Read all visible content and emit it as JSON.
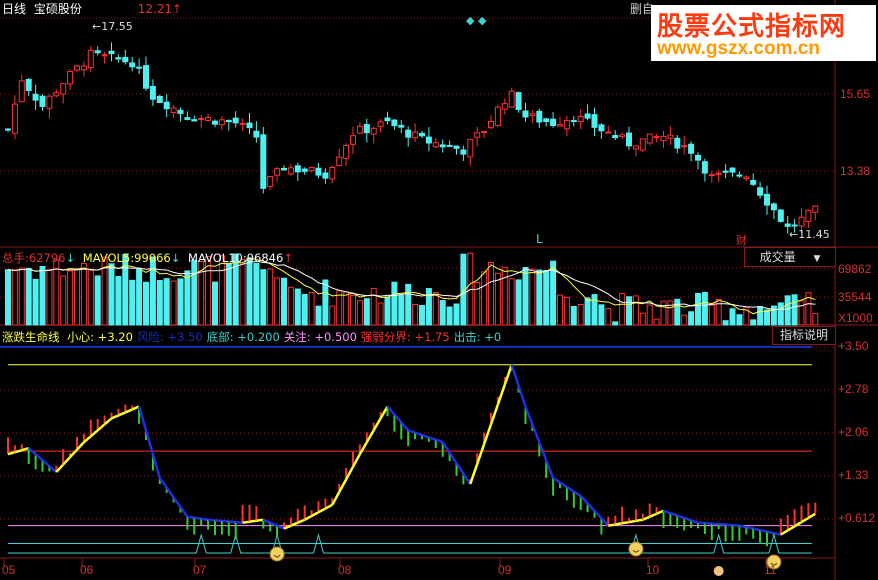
{
  "header": {
    "period": "日线",
    "stock_name": "宝硕股份",
    "price": "12.21",
    "price_dir": "up",
    "menu_label": "删自"
  },
  "watermark": {
    "title": "股票公式指标网",
    "url": "www.gszx.com.cn"
  },
  "price_panel": {
    "axis_labels": [
      "15.65",
      "13.38"
    ],
    "high_label": "17.55",
    "low_label": "11.45",
    "markers": [
      "L",
      "财"
    ]
  },
  "volume_panel": {
    "total_label": "总手:",
    "total": "62796",
    "mavol5_label": "MAVOL5:",
    "mavol5": "99066",
    "mavol10_label": "MAVOL10:",
    "mavol10": "96846",
    "selector": "成交量",
    "axis_labels": [
      "69862",
      "35544",
      "X1000"
    ]
  },
  "indicator_panel": {
    "name": "涨跌生命线",
    "params": [
      {
        "label": "小心:",
        "value": "+3.20",
        "color": "#ffff40"
      },
      {
        "label": "风险:",
        "value": "+3.50",
        "color": "#1030c0"
      },
      {
        "label": "底部:",
        "value": "+0.200",
        "color": "#40d0d0"
      },
      {
        "label": "关注:",
        "value": "+0.500",
        "color": "#ff90ff"
      },
      {
        "label": "强弱分界:",
        "value": "+1.75",
        "color": "#ff3030"
      },
      {
        "label": "出击:",
        "value": "+0",
        "color": "#40d0d0"
      }
    ],
    "explain_button": "指标说明",
    "axis_labels": [
      "+3.50",
      "+2.78",
      "+2.06",
      "+1.33",
      "+0.612"
    ]
  },
  "x_axis": {
    "labels": [
      "05",
      "06",
      "07",
      "08",
      "09",
      "10",
      "11"
    ]
  },
  "chart_data": {
    "type": "candlestick",
    "price_path": [
      [
        0,
        14.6
      ],
      [
        2,
        16.1
      ],
      [
        5,
        15.3
      ],
      [
        8,
        16.0
      ],
      [
        12,
        16.8
      ],
      [
        18,
        16.6
      ],
      [
        21,
        15.6
      ],
      [
        26,
        15.0
      ],
      [
        33,
        14.8
      ],
      [
        36,
        14.4
      ],
      [
        37,
        12.9
      ],
      [
        40,
        13.5
      ],
      [
        46,
        13.3
      ],
      [
        50,
        14.5
      ],
      [
        55,
        14.8
      ],
      [
        60,
        14.3
      ],
      [
        66,
        14.0
      ],
      [
        69,
        14.6
      ],
      [
        72,
        15.5
      ],
      [
        73,
        15.6
      ],
      [
        75,
        15.0
      ],
      [
        79,
        14.8
      ],
      [
        82,
        15.0
      ],
      [
        86,
        14.6
      ],
      [
        90,
        14.2
      ],
      [
        95,
        14.4
      ],
      [
        99,
        14.0
      ],
      [
        102,
        13.2
      ],
      [
        107,
        13.3
      ],
      [
        110,
        12.5
      ],
      [
        113,
        11.7
      ],
      [
        117,
        12.2
      ]
    ],
    "indicator_path": [
      [
        0,
        1.7
      ],
      [
        3,
        1.8
      ],
      [
        7,
        1.4
      ],
      [
        11,
        1.9
      ],
      [
        15,
        2.3
      ],
      [
        19,
        2.5
      ],
      [
        22,
        1.3
      ],
      [
        26,
        0.65
      ],
      [
        29,
        0.6
      ],
      [
        34,
        0.55
      ],
      [
        37,
        0.6
      ],
      [
        40,
        0.45
      ],
      [
        43,
        0.6
      ],
      [
        47,
        0.85
      ],
      [
        51,
        1.7
      ],
      [
        55,
        2.5
      ],
      [
        58,
        2.1
      ],
      [
        63,
        1.9
      ],
      [
        67,
        1.2
      ],
      [
        70,
        2.2
      ],
      [
        73,
        3.2
      ],
      [
        75,
        2.5
      ],
      [
        79,
        1.3
      ],
      [
        83,
        1.0
      ],
      [
        87,
        0.5
      ],
      [
        92,
        0.6
      ],
      [
        95,
        0.75
      ],
      [
        100,
        0.55
      ],
      [
        106,
        0.5
      ],
      [
        112,
        0.35
      ],
      [
        117,
        0.7
      ]
    ],
    "signal_points": [
      28,
      33,
      39,
      45,
      91,
      103,
      111
    ],
    "lines": {
      "caution": 3.2,
      "risk": 3.5,
      "divide": 1.75,
      "watch": 0.5,
      "bottom": 0.2
    }
  }
}
